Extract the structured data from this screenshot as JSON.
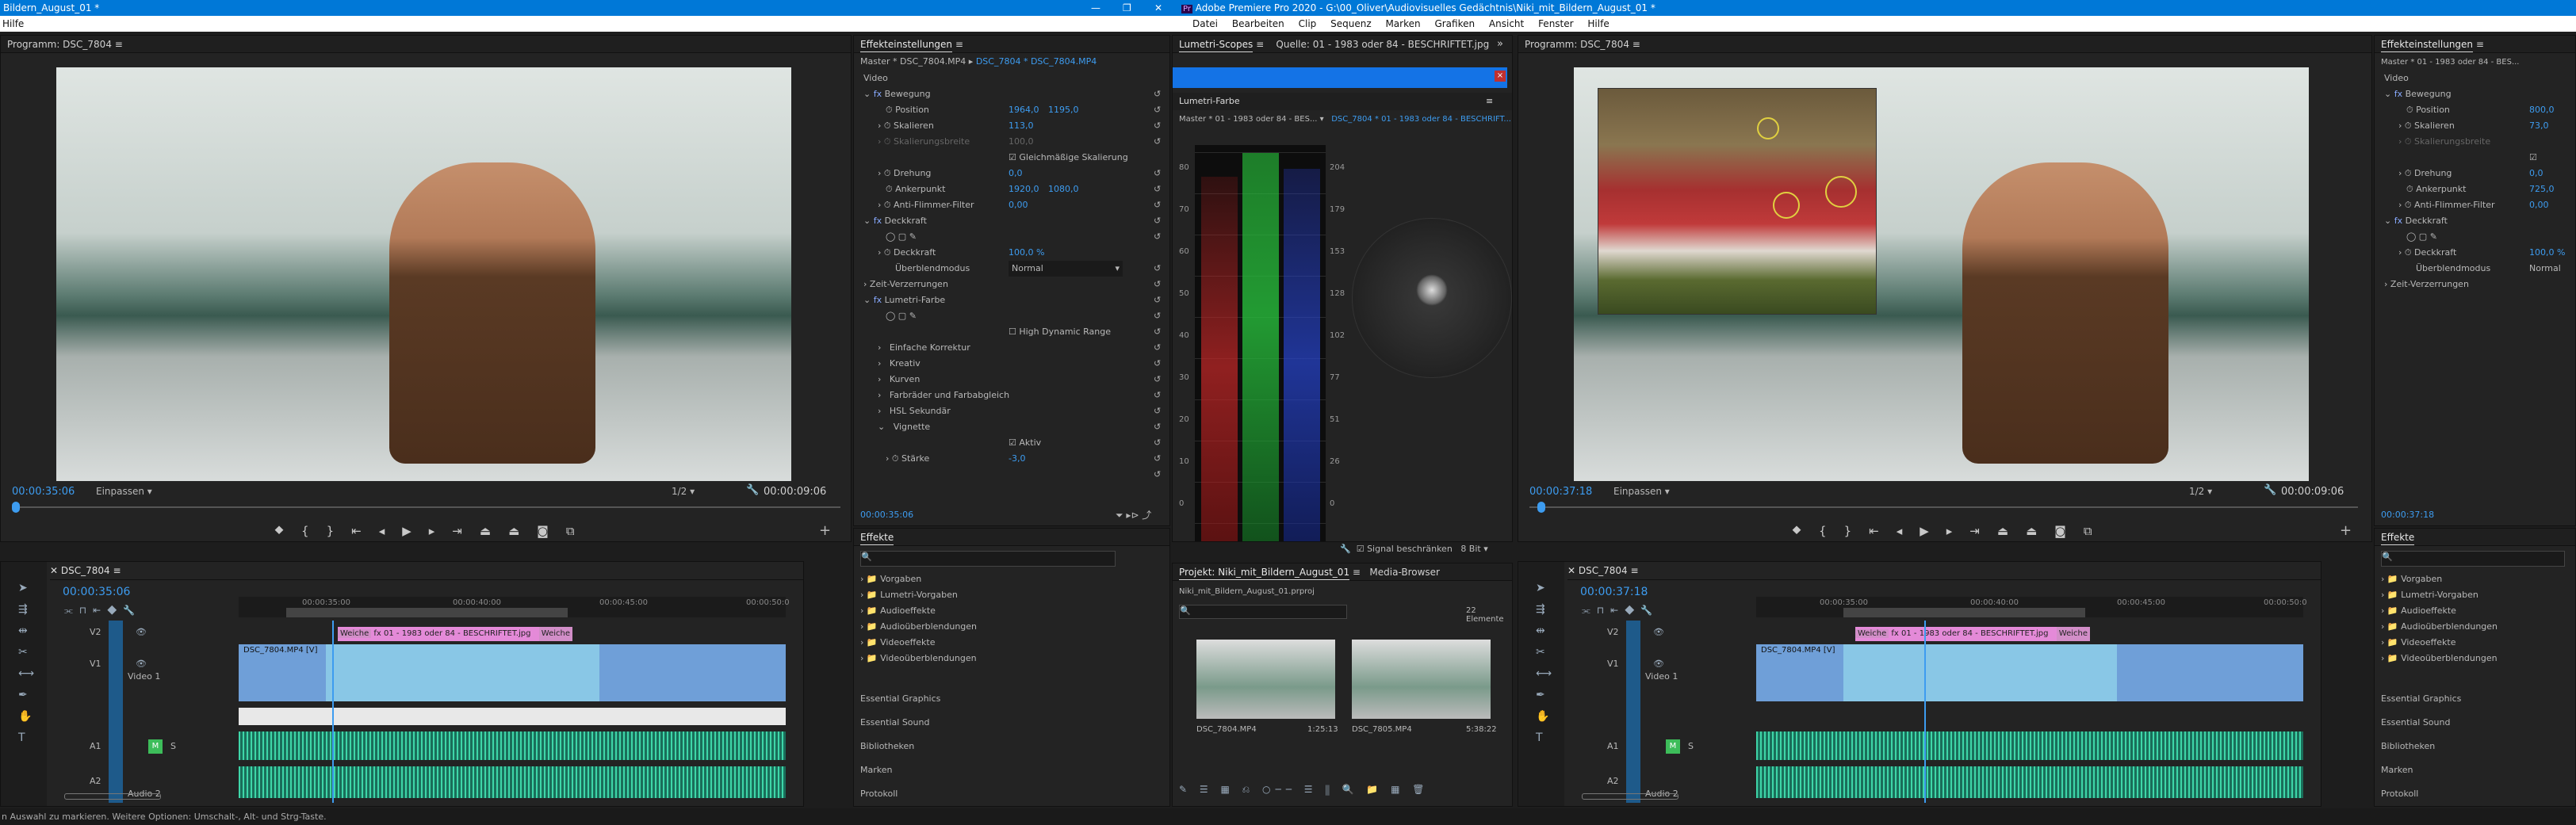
{
  "window": {
    "title_left": "Bildern_August_01 *",
    "title_right": "Adobe Premiere Pro 2020 - G:\\00_Oliver\\Audiovisuelles Gedächtnis\\Niki_mit_Bildern_August_01 *",
    "app_icon": "Pr"
  },
  "menu": {
    "left": "Hilfe",
    "items": [
      "Datei",
      "Bearbeiten",
      "Clip",
      "Sequenz",
      "Marken",
      "Grafiken",
      "Ansicht",
      "Fenster",
      "Hilfe"
    ]
  },
  "program_left": {
    "title": "Programm: DSC_7804",
    "timecode": "00:00:35:06",
    "fit": "Einpassen",
    "ratio": "1/2",
    "duration": "00:00:09:06"
  },
  "program_right": {
    "title": "Programm: DSC_7804",
    "timecode": "00:00:37:18",
    "fit": "Einpassen",
    "ratio": "1/2",
    "duration": "00:00:09:06"
  },
  "effect_controls": {
    "title": "Effekteinstellungen",
    "master": "Master * DSC_7804.MP4",
    "clip": "DSC_7804 * DSC_7804.MP4",
    "section": "Video",
    "bewegung": "Bewegung",
    "position_label": "Position",
    "position_x": "1964,0",
    "position_y": "1195,0",
    "skal_label": "Skalieren",
    "skal_val": "113,0",
    "skalbreite_label": "Skalierungsbreite",
    "skalbreite_val": "100,0",
    "gleich": "Gleichmäßige Skalierung",
    "drehung_label": "Drehung",
    "drehung_val": "0,0",
    "anker_label": "Ankerpunkt",
    "anker_x": "1920,0",
    "anker_y": "1080,0",
    "flimmer_label": "Anti-Flimmer-Filter",
    "flimmer_val": "0,00",
    "deckkraft": "Deckkraft",
    "deck_label": "Deckkraft",
    "deck_val": "100,0 %",
    "ueber_label": "Überblendmodus",
    "ueber_val": "Normal",
    "zeit": "Zeit-Verzerrungen",
    "lumetri": "Lumetri-Farbe",
    "hdr": "High Dynamic Range",
    "sub": [
      "Einfache Korrektur",
      "Kreativ",
      "Kurven",
      "Farbräder und Farbabgleich",
      "HSL Sekundär",
      "Vignette"
    ],
    "aktiv": "Aktiv",
    "staerke_label": "Stärke",
    "staerke_val": "-3,0",
    "timecode": "00:00:35:06"
  },
  "effect_controls_right": {
    "title": "Effekteinstellungen",
    "master": "Master * 01 - 1983 oder 84 - BES...",
    "section": "Video",
    "bewegung": "Bewegung",
    "position_label": "Position",
    "position_x": "800,0",
    "skal_label": "Skalieren",
    "skal_val": "73,0",
    "skalbreite_label": "Skalierungsbreite",
    "drehung_label": "Drehung",
    "drehung_val": "0,0",
    "anker_label": "Ankerpunkt",
    "anker_x": "725,0",
    "flimmer_label": "Anti-Flimmer-Filter",
    "flimmer_val": "0,00",
    "deckkraft": "Deckkraft",
    "deck_label": "Deckkraft",
    "deck_val": "100,0 %",
    "ueber_label": "Überblendmodus",
    "ueber_val": "Normal",
    "zeit": "Zeit-Verzerrungen",
    "timecode": "00:00:37:18"
  },
  "scopes": {
    "tab1": "Lumetri-Scopes",
    "tab2": "Quelle: 01 - 1983 oder 84 - BESCHRIFTET.jpg",
    "lumetri_title": "Lumetri-Farbe",
    "master": "Master * 01 - 1983 oder 84 - BES...",
    "clip": "DSC_7804 * 01 - 1983 oder 84 - BESCHRIFT...",
    "left_scale": [
      "80",
      "70",
      "60",
      "50",
      "40",
      "30",
      "20",
      "10",
      "0"
    ],
    "right_scale": [
      "204",
      "179",
      "153",
      "128",
      "102",
      "77",
      "51",
      "26",
      "0"
    ],
    "signal": "Signal beschränken",
    "bits": "8 Bit"
  },
  "effects_left": {
    "title": "Effekte",
    "items": [
      "Vorgaben",
      "Lumetri-Vorgaben",
      "Audioeffekte",
      "Audioüberblendungen",
      "Videoeffekte",
      "Videoüberblendungen"
    ],
    "extra": [
      "Essential Graphics",
      "Essential Sound",
      "Bibliotheken",
      "Marken",
      "Protokoll"
    ]
  },
  "effects_right": {
    "title": "Effekte",
    "items": [
      "Vorgaben",
      "Lumetri-Vorgaben",
      "Audioeffekte",
      "Audioüberblendungen",
      "Videoeffekte",
      "Videoüberblendungen"
    ],
    "extra": [
      "Essential Graphics",
      "Essential Sound",
      "Bibliotheken",
      "Marken",
      "Protokoll"
    ]
  },
  "project": {
    "tab1": "Projekt: Niki_mit_Bildern_August_01",
    "tab2": "Media-Browser",
    "file": "Niki_mit_Bildern_August_01.prproj",
    "count": "22 Elemente",
    "clips": [
      {
        "name": "DSC_7804.MP4",
        "dur": "1:25:13"
      },
      {
        "name": "DSC_7805.MP4",
        "dur": "5:38:22"
      }
    ]
  },
  "timeline_left": {
    "title": "DSC_7804",
    "timecode": "00:00:35:06",
    "ruler": [
      "00:00:35:00",
      "00:00:40:00",
      "00:00:45:00",
      "00:00:50:0"
    ],
    "clip_pink": "01 - 1983 oder 84 - BESCHRIFTET.jpg",
    "weiche1": "Weiche",
    "weiche2": "Weiche",
    "clip_blue": "DSC_7804.MP4 [V]",
    "tracks": [
      "V2",
      "V1",
      "A1",
      "A2"
    ],
    "video1": "Video 1",
    "audio2": "Audio 2",
    "s": "S",
    "m": "M"
  },
  "timeline_right": {
    "title": "DSC_7804",
    "timecode": "00:00:37:18",
    "ruler": [
      "00:00:35:00",
      "00:00:40:00",
      "00:00:45:00",
      "00:00:50:0"
    ],
    "clip_pink": "01 - 1983 oder 84 - BESCHRIFTET.jpg",
    "weiche1": "Weiche",
    "weiche2": "Weiche",
    "clip_blue": "DSC_7804.MP4 [V]",
    "tracks": [
      "V2",
      "V1",
      "A1",
      "A2"
    ],
    "video1": "Video 1",
    "audio2": "Audio 2",
    "s": "S",
    "m": "M"
  },
  "status": "n Auswahl zu markieren. Weitere Optionen: Umschalt-, Alt- und Strg-Taste.",
  "colors": {
    "accent": "#3d9cf0",
    "titlebar": "#0078d7",
    "clip_pink": "#e48ad8",
    "audio": "#3ed6a8"
  }
}
